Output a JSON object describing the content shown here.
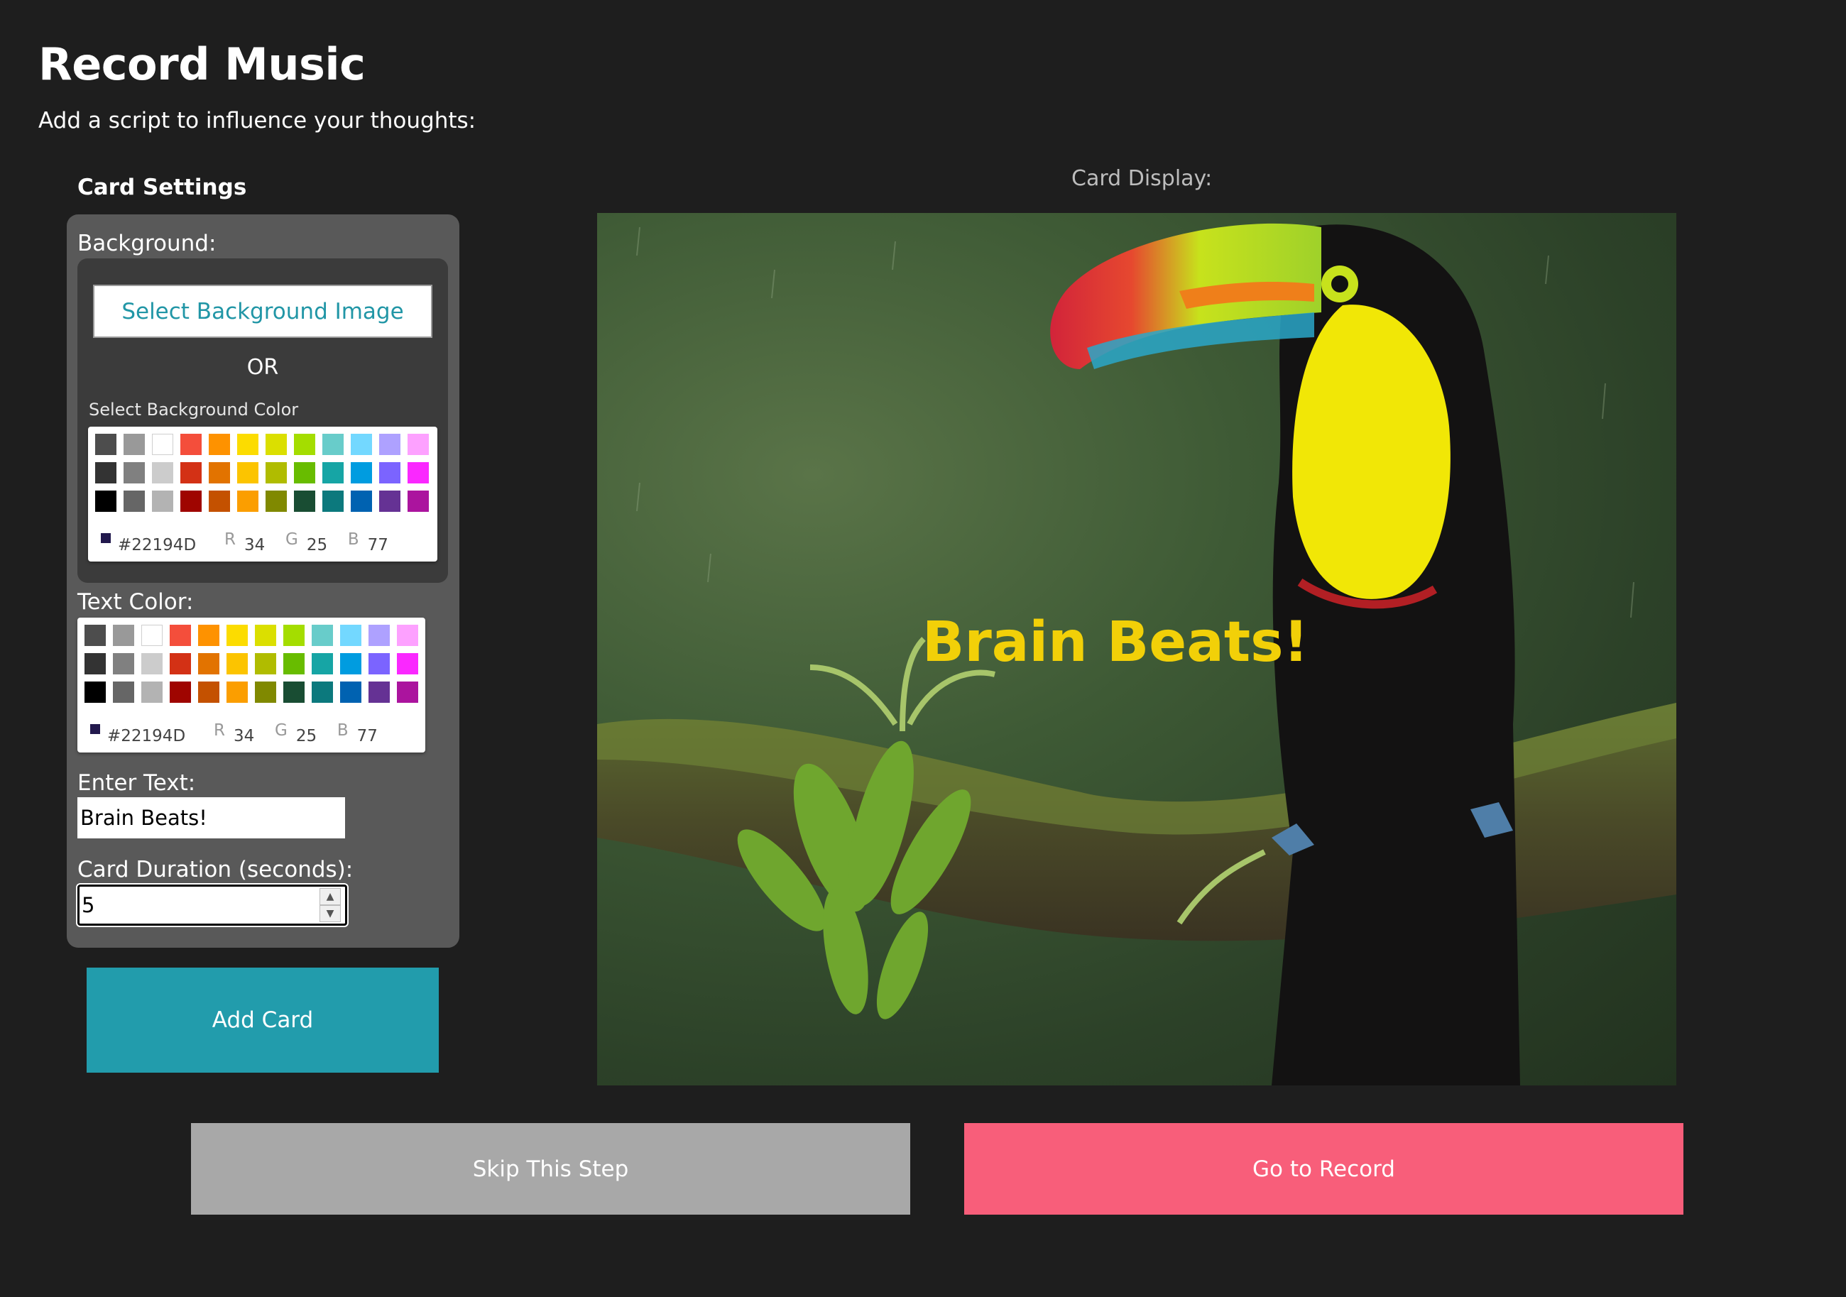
{
  "header": {
    "title": "Record Music",
    "subtitle": "Add a script to influence your thoughts:"
  },
  "settings": {
    "heading": "Card Settings",
    "background_label": "Background:",
    "select_image_label": "Select Background Image",
    "or_label": "OR",
    "bg_color_label": "Select Background Color",
    "text_color_label": "Text Color:",
    "enter_text_label": "Enter Text:",
    "text_value": "Brain Beats!",
    "duration_label": "Card Duration (seconds):",
    "duration_value": "5",
    "add_card_label": "Add Card"
  },
  "palette": [
    "#4d4d4d",
    "#999999",
    "#ffffff",
    "#f44e3b",
    "#fe9200",
    "#fcdc00",
    "#dbdf00",
    "#a4dd00",
    "#68ccca",
    "#73d8ff",
    "#aea1ff",
    "#fda1ff",
    "#333333",
    "#808080",
    "#cccccc",
    "#d33115",
    "#e27300",
    "#fcc400",
    "#b0bc00",
    "#68bc00",
    "#16a5a5",
    "#009ce0",
    "#7b64ff",
    "#fa28ff",
    "#000000",
    "#666666",
    "#b3b3b3",
    "#9f0500",
    "#c45100",
    "#fb9e00",
    "#808900",
    "#194d33",
    "#0c797d",
    "#0062b1",
    "#653294",
    "#ab149e"
  ],
  "bg_color": {
    "hex": "#22194D",
    "r_label": "R",
    "r": "34",
    "g_label": "G",
    "g": "25",
    "b_label": "B",
    "b": "77"
  },
  "text_color": {
    "hex": "#22194D",
    "r_label": "R",
    "r": "34",
    "g_label": "G",
    "g": "25",
    "b_label": "B",
    "b": "77"
  },
  "display": {
    "label": "Card Display:",
    "card_text": "Brain Beats!",
    "card_text_color": "#f2d008"
  },
  "actions": {
    "skip_label": "Skip This Step",
    "record_label": "Go to Record"
  },
  "colors": {
    "accent": "#229cac",
    "record": "#f85e7a",
    "skip": "#a8a8a8",
    "background": "#1e1e1e"
  },
  "icons": {
    "stepper_up": "chevron-up-icon",
    "stepper_down": "chevron-down-icon"
  }
}
